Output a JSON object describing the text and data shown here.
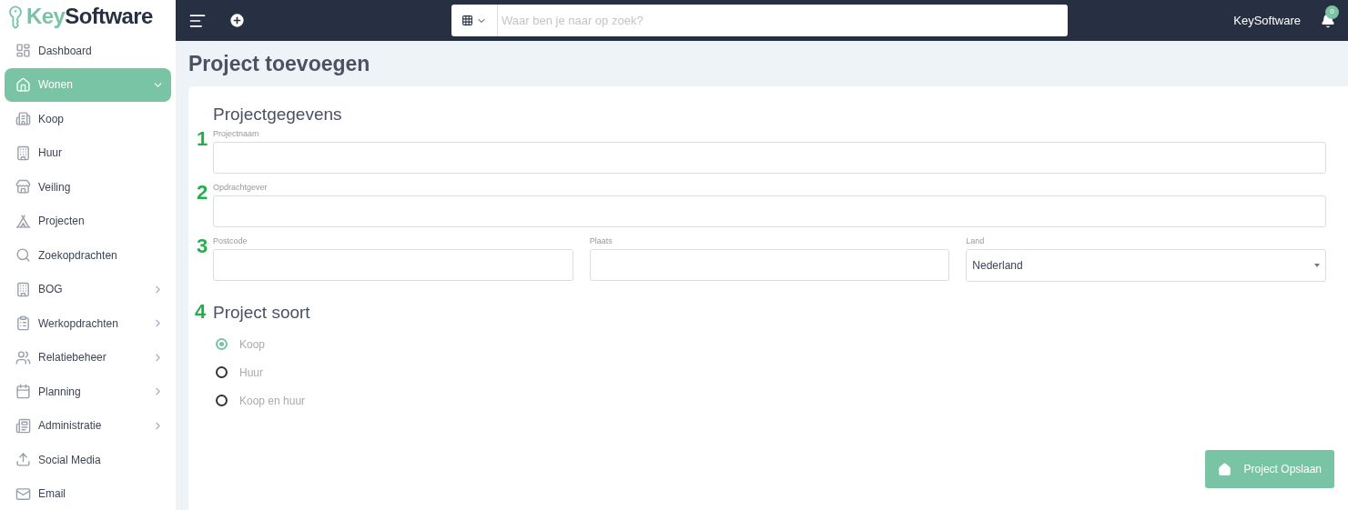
{
  "logo": {
    "part1": "Key",
    "part2": "Software"
  },
  "sidebar": {
    "items": [
      {
        "label": "Dashboard",
        "selected": false
      },
      {
        "label": "Wonen",
        "selected": true,
        "expanded": true
      },
      {
        "label": "Koop",
        "selected": false
      },
      {
        "label": "Huur",
        "selected": false
      },
      {
        "label": "Veiling",
        "selected": false
      },
      {
        "label": "Projecten",
        "selected": false
      },
      {
        "label": "Zoekopdrachten",
        "selected": false
      },
      {
        "label": "BOG",
        "selected": false,
        "expanded": false
      },
      {
        "label": "Werkopdrachten",
        "selected": false,
        "expanded": false
      },
      {
        "label": "Relatiebeheer",
        "selected": false,
        "expanded": false
      },
      {
        "label": "Planning",
        "selected": false,
        "expanded": false
      },
      {
        "label": "Administratie",
        "selected": false,
        "expanded": false
      },
      {
        "label": "Social Media",
        "selected": false
      },
      {
        "label": "Email",
        "selected": false
      }
    ]
  },
  "topbar": {
    "search": {
      "placeholder": "Waar ben je naar op zoek?"
    },
    "user": "KeySoftware",
    "notifications": "0"
  },
  "page_title": "Project toevoegen",
  "form": {
    "section_title": "Projectgegevens",
    "rows": [
      {
        "step": "1",
        "fields": [
          {
            "label": "Projectnaam",
            "kind": "text"
          }
        ]
      },
      {
        "step": "2",
        "fields": [
          {
            "label": "Opdrachtgever",
            "kind": "text"
          }
        ]
      },
      {
        "step": "3",
        "fields": [
          {
            "label": "Postcode",
            "kind": "text"
          },
          {
            "label": "Plaats",
            "kind": "text"
          },
          {
            "label": "Land",
            "kind": "select",
            "value": "Nederland"
          }
        ]
      }
    ],
    "type_step": "4",
    "type_title": "Project soort",
    "options": [
      {
        "label": "Koop",
        "selected": true
      },
      {
        "label": "Huur",
        "selected": false
      },
      {
        "label": "Koop en huur",
        "selected": false
      }
    ],
    "save_button": "Project Opslaan"
  }
}
